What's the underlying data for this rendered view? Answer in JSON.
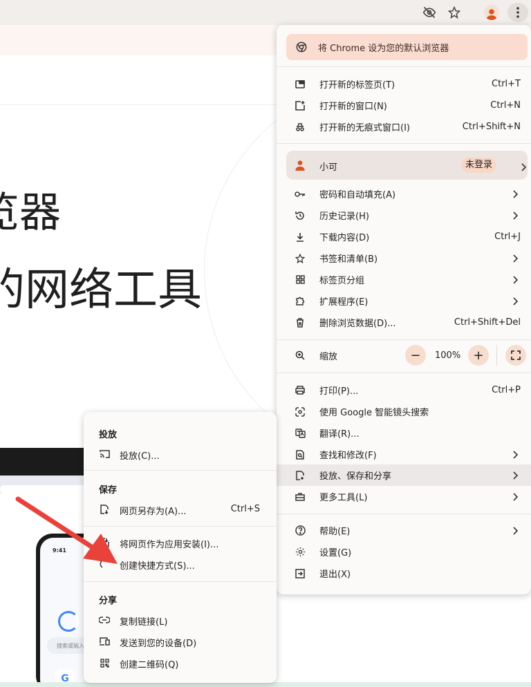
{
  "menu": {
    "default_banner": "将 Chrome 设为您的默认浏览器",
    "new_group": [
      {
        "label": "打开新的标签页(T)",
        "shortcut": "Ctrl+T",
        "icon": "new-tab-icon"
      },
      {
        "label": "打开新的窗口(N)",
        "shortcut": "Ctrl+N",
        "icon": "new-window-icon"
      },
      {
        "label": "打开新的无痕式窗口(I)",
        "shortcut": "Ctrl+Shift+N",
        "icon": "incognito-icon"
      }
    ],
    "profile": {
      "name": "小可",
      "status": "未登录"
    },
    "browse_group": [
      {
        "label": "密码和自动填充(A)",
        "shortcut": "",
        "icon": "key-icon",
        "submenu": true
      },
      {
        "label": "历史记录(H)",
        "shortcut": "",
        "icon": "history-icon",
        "submenu": true
      },
      {
        "label": "下载内容(D)",
        "shortcut": "Ctrl+J",
        "icon": "download-icon",
        "submenu": false
      },
      {
        "label": "书签和清单(B)",
        "shortcut": "",
        "icon": "star-icon",
        "submenu": true
      },
      {
        "label": "标签页分组",
        "shortcut": "",
        "icon": "tab-groups-icon",
        "submenu": true
      },
      {
        "label": "扩展程序(E)",
        "shortcut": "",
        "icon": "extension-icon",
        "submenu": true
      },
      {
        "label": "删除浏览数据(D)...",
        "shortcut": "Ctrl+Shift+Del",
        "icon": "trash-icon",
        "submenu": false
      }
    ],
    "zoom": {
      "label": "缩放",
      "value": "100%",
      "minus": "−",
      "plus": "+"
    },
    "tools_group": [
      {
        "label": "打印(P)...",
        "shortcut": "Ctrl+P",
        "icon": "print-icon",
        "submenu": false
      },
      {
        "label": "使用 Google 智能镜头搜索",
        "shortcut": "",
        "icon": "lens-icon",
        "submenu": false
      },
      {
        "label": "翻译(R)...",
        "shortcut": "",
        "icon": "translate-icon",
        "submenu": false
      },
      {
        "label": "查找和修改(F)",
        "shortcut": "",
        "icon": "find-icon",
        "submenu": true
      },
      {
        "label": "投放、保存和分享",
        "shortcut": "",
        "icon": "save-share-icon",
        "submenu": true,
        "highlighted": true
      },
      {
        "label": "更多工具(L)",
        "shortcut": "",
        "icon": "toolbox-icon",
        "submenu": true
      }
    ],
    "help_group": [
      {
        "label": "帮助(E)",
        "shortcut": "",
        "icon": "help-icon",
        "submenu": true
      },
      {
        "label": "设置(G)",
        "shortcut": "",
        "icon": "settings-icon",
        "submenu": false
      },
      {
        "label": "退出(X)",
        "shortcut": "",
        "icon": "exit-icon",
        "submenu": false
      }
    ]
  },
  "submenu": {
    "cast": {
      "heading": "投放",
      "items": [
        {
          "label": "投放(C)...",
          "shortcut": "",
          "icon": "cast-icon"
        }
      ]
    },
    "save": {
      "heading": "保存",
      "items": [
        {
          "label": "网页另存为(A)...",
          "shortcut": "Ctrl+S",
          "icon": "save-page-icon"
        },
        {
          "label": "将网页作为应用安装(I)...",
          "shortcut": "",
          "icon": "install-app-icon"
        },
        {
          "label": "创建快捷方式(S)...",
          "shortcut": "",
          "icon": "shortcut-icon"
        }
      ]
    },
    "share": {
      "heading": "分享",
      "items": [
        {
          "label": "复制链接(L)",
          "shortcut": "",
          "icon": "link-icon"
        },
        {
          "label": "发送到您的设备(D)",
          "shortcut": "",
          "icon": "send-device-icon"
        },
        {
          "label": "创建二维码(Q)",
          "shortcut": "",
          "icon": "qr-code-icon"
        }
      ]
    }
  },
  "page": {
    "hero_line1": "览器",
    "hero_line2": "的网络工具",
    "phone_time": "9:41",
    "phone_search_placeholder": "搜索或输入",
    "phone_app_letter": "G"
  },
  "colors": {
    "accent": "#f7ddd0",
    "profile_orange": "#d9541e",
    "arrow_red": "#e8423a"
  }
}
